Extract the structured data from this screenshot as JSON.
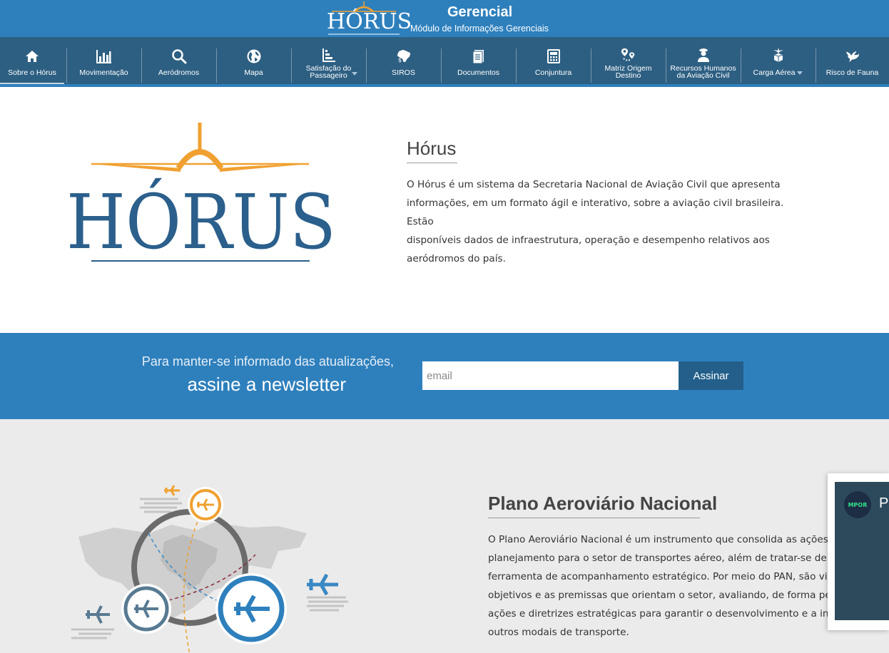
{
  "header": {
    "logo_text": "HÓRUS",
    "title": "Gerencial",
    "subtitle": "Módulo de Informações Gerenciais"
  },
  "nav": {
    "items": [
      {
        "label": "Sobre o Hórus",
        "icon": "home-icon"
      },
      {
        "label": "Movimentação",
        "icon": "bar-chart-icon"
      },
      {
        "label": "Aeródromos",
        "icon": "search-icon"
      },
      {
        "label": "Mapa",
        "icon": "globe-icon"
      },
      {
        "label": "Satisfação do Passageiro",
        "icon": "ranking-icon"
      },
      {
        "label": "SIROS",
        "icon": "brazil-map-icon"
      },
      {
        "label": "Documentos",
        "icon": "document-icon"
      },
      {
        "label": "Conjuntura",
        "icon": "calculator-icon"
      },
      {
        "label": "Matriz Origem Destino",
        "icon": "route-pins-icon"
      },
      {
        "label": "Recursos Humanos da Aviação Civil",
        "icon": "pilot-icon"
      },
      {
        "label": "Carga Aérea",
        "icon": "cargo-icon"
      },
      {
        "label": "Risco de Fauna",
        "icon": "bird-icon"
      }
    ]
  },
  "about": {
    "logo_text": "HÓRUS",
    "title": "Hórus",
    "lines": [
      "O Hórus é um sistema da Secretaria Nacional de Aviação Civil que apresenta",
      "informações, em um formato ágil e interativo, sobre a aviação civil brasileira. Estão",
      "disponíveis dados de infraestrutura, operação e desempenho relativos aos",
      "aeródromos do país."
    ]
  },
  "newsletter": {
    "line1": "Para manter-se informado das atualizações,",
    "line2": "assine a newsletter",
    "email_placeholder": "email",
    "button_label": "Assinar"
  },
  "pan": {
    "title": "Plano Aeroviário Nacional",
    "lines": [
      "O Plano Aeroviário Nacional é um instrumento que consolida as ações de",
      "planejamento para o setor de transportes aéreo, além de tratar-se de uma",
      "ferramenta de acompanhamento estratégico. Por meio do PAN, são vistos",
      "objetivos e as premissas que orientam o setor, avaliando, de forma permanente,",
      "ações e diretrizes estratégicas para garantir o desenvolvimento e a integração com",
      "outros modais de transporte."
    ]
  },
  "widget": {
    "avatar_text": "MPOR",
    "text": "Pe"
  },
  "colors": {
    "header_blue": "#2e80bd",
    "nav_dark": "#2d5f82",
    "logo_blue": "#2b5f8c",
    "logo_orange": "#f0a030"
  }
}
